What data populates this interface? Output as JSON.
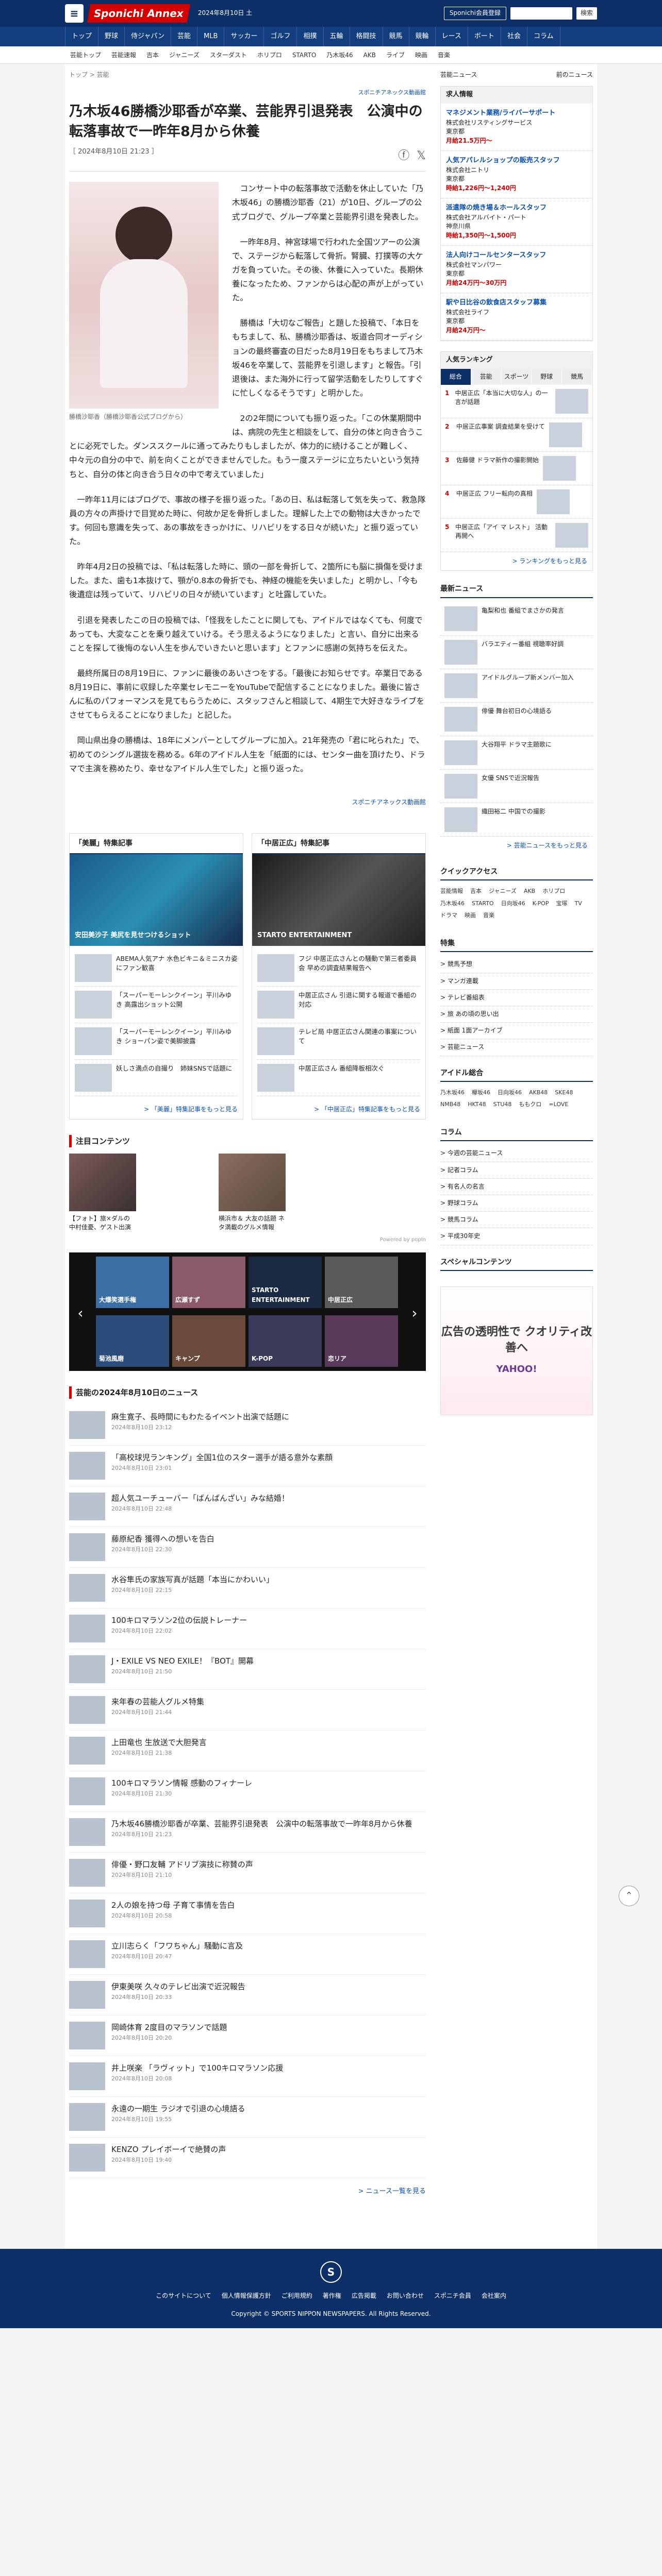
{
  "header": {
    "brand": "Sponichi Annex",
    "date": "2024年8月10日 土",
    "top_link": "Sponichi会員登録",
    "search_button": "検索"
  },
  "nav1": [
    "トップ",
    "野球",
    "侍ジャパン",
    "芸能",
    "MLB",
    "サッカー",
    "ゴルフ",
    "相撲",
    "五輪",
    "格闘技",
    "競馬",
    "競輪",
    "レース",
    "ボート",
    "社会",
    "コラム"
  ],
  "nav2": [
    "芸能トップ",
    "芸能速報",
    "吉本",
    "ジャニーズ",
    "スターダスト",
    "ホリプロ",
    "STARTO",
    "乃木坂46",
    "AKB",
    "ライブ",
    "映画",
    "音楽"
  ],
  "breadcrumb": "トップ > 芸能",
  "article": {
    "sponsor_label": "スポニチアネックス動画館",
    "title": "乃木坂46勝橋沙耶香が卒業、芸能界引退発表　公演中の転落事故で一昨年8月から休養",
    "datetime": "［ 2024年8月10日 21:23 ］",
    "caption": "勝橋沙耶香（勝橋沙耶香公式ブログから）",
    "paragraphs": [
      "コンサート中の転落事故で活動を休止していた「乃木坂46」の勝橋沙耶香（21）が10日、グループの公式ブログで、グループ卒業と芸能界引退を発表した。",
      "一昨年8月、神宮球場で行われた全国ツアーの公演で、ステージから転落して骨折。腎臓、打撲等の大ケガを負っていた。その後、休養に入っていた。長期休養になったため、ファンからは心配の声が上がっていた。",
      "勝橋は「大切なご報告」と題した投稿で、「本日をもちまして、私、勝橋沙耶香は、坂道合同オーディションの最終審査の日だった8月19日をもちまして乃木坂46を卒業して、芸能界を引退します」と報告。「引退後は、また海外に行って留学活動をしたりしてすぐに忙しくなるそうです」と明かした。",
      "2の2年間についても振り返った。「この休業期間中は、病院の先生と相談をして、自分の体と向き合うことに必死でした。ダンススクールに通ってみたりもしましたが、体力的に続けることが難しく、中々元の自分の中で、前を向くことができませんでした。もう一度ステージに立ちたいという気持ちと、自分の体と向き合う日々の中で考えていました」",
      "一昨年11月にはブログで、事故の様子を振り返った。「あの日、私は転落して気を失って、救急隊員の方々の声掛けで目覚めた時に、何故か足を骨折しました。理解した上での動物は大きかったです。何回も意識を失って、あの事故をきっかけに、リハビリをする日々が続いた」と振り返っていた。",
      "昨年4月2日の投稿では、「私は転落した時に、頭の一部を骨折して、2箇所にも脳に損傷を受けました。また、歯も1本抜けて、顎が0.8本の骨折でも、神経の機能を失いました」と明かし、「今も後遺症は残っていて、リハビリの日々が続いています」と吐露していた。",
      "引退を発表したこの日の投稿では、「怪我をしたことに関しても、アイドルではなくても、何度であっても、大変なことを乗り越えていける。そう思えるようになりました」と言い、自分に出来ることを探して後悔のない人生を歩んでいきたいと思います」とファンに感謝の気持ちを伝えた。",
      "最終所属日の8月19日に、ファンに最後のあいさつをする。「最後にお知らせです。卒業日である8月19日に、事前に収録した卒業セレモニーをYouTubeで配信することになりました。最後に皆さんに私のパフォーマンスを見てもらうために、スタッフさんと相談して、4期生で大好きなライブをさせてもらえることになりました」と記した。",
      "岡山県出身の勝橋は、18年にメンバーとしてグループに加入。21年発売の「君に叱られた」で、初めてのシングル選抜を務める。6年のアイドル人生を「紙面的には、センター曲を頂けたり、ドラマで主演を務めたり、幸せなアイドル人生でした」と振り返った。"
    ],
    "sponsor_bottom": "スポニチアネックス動画館"
  },
  "cards": [
    {
      "head": "「美麗」特集記事",
      "img_caption": "安田美沙子 美尻を見せつけるショット",
      "items": [
        "ABEMA人気アナ 水色ビキニ＆ミニスカ姿にファン歓喜",
        "「スーパーモーレンクイーン」平川みゆき 高露出ショット公開",
        "「スーパーモーレンクイーン」平川みゆき ショーパン姿で美脚披露",
        "妖しさ満点の自撮り　姉妹SNSで話題に"
      ],
      "more": "> 「美麗」特集記事をもっと見る"
    },
    {
      "head": "「中居正広」特集記事",
      "img_caption": "STARTO ENTERTAINMENT",
      "items": [
        "フジ 中居正広さんとの騒動で第三者委員会 早めの調査結果報告へ",
        "中居正広さん 引退に関する報道で番組の対応",
        "テレビ局 中居正広さん関連の事案について",
        "中居正広さん 番組降板相次ぐ"
      ],
      "more": "> 「中居正広」特集記事をもっと見る"
    }
  ],
  "attention": {
    "title": "注目コンテンツ",
    "items": [
      "【フォト】旅×ダルの中村佳憂、ゲスト出演",
      "横浜市＆ 大友の話題 ネタ満載のグルメ情報"
    ],
    "powered": "Powered by popIn"
  },
  "carousel": [
    "大爆笑選手権",
    "広瀬すず",
    "STARTO ENTERTAINMENT",
    "中居正広",
    "菊池風磨",
    "キャンプ",
    "K-POP",
    "恋リア"
  ],
  "news_list": {
    "title": "芸能の2024年8月10日のニュース",
    "items": [
      {
        "text": "麻生寛子、長時間にもわたるイベント出演で話題に",
        "date": "2024年8月10日 23:12"
      },
      {
        "text": "「高校球児ランキング」全国1位のスター選手が語る意外な素顔",
        "date": "2024年8月10日 23:01"
      },
      {
        "text": "超人気ユーチューバー「ばんばんざい」みな結婚！",
        "date": "2024年8月10日 22:48"
      },
      {
        "text": "藤原紀香 獲得への想いを告白",
        "date": "2024年8月10日 22:30"
      },
      {
        "text": "水谷隼氏の家族写真が話題「本当にかわいい」",
        "date": "2024年8月10日 22:15"
      },
      {
        "text": "100キロマラソン2位の伝説トレーナー",
        "date": "2024年8月10日 22:02"
      },
      {
        "text": "J・EXILE VS NEO EXILE！『BOT』開幕",
        "date": "2024年8月10日 21:50"
      },
      {
        "text": "来年春の芸能人グルメ特集",
        "date": "2024年8月10日 21:44"
      },
      {
        "text": "上田竜也 生放送で大胆発言",
        "date": "2024年8月10日 21:38"
      },
      {
        "text": "100キロマラソン情報 感動のフィナーレ",
        "date": "2024年8月10日 21:30"
      },
      {
        "text": "乃木坂46勝橋沙耶香が卒業、芸能界引退発表　公演中の転落事故で一昨年8月から休養",
        "date": "2024年8月10日 21:23"
      },
      {
        "text": "俳優・野口友輔 アドリブ演技に称賛の声",
        "date": "2024年8月10日 21:10"
      },
      {
        "text": "2人の娘を持つ母 子育て事情を告白",
        "date": "2024年8月10日 20:58"
      },
      {
        "text": "立川志らく「フワちゃん」騒動に言及",
        "date": "2024年8月10日 20:47"
      },
      {
        "text": "伊東美咲 久々のテレビ出演で近況報告",
        "date": "2024年8月10日 20:33"
      },
      {
        "text": "岡崎体育 2度目のマラソンで話題",
        "date": "2024年8月10日 20:20"
      },
      {
        "text": "井上咲楽 「ラヴィット」で100キロマラソン応援",
        "date": "2024年8月10日 20:08"
      },
      {
        "text": "永遠の一期生 ラジオで引退の心境語る",
        "date": "2024年8月10日 19:55"
      },
      {
        "text": "KENZO プレイボーイで絶賛の声",
        "date": "2024年8月10日 19:40"
      }
    ],
    "more": "> ニュース一覧を見る"
  },
  "sidebar": {
    "news_label": "芸能ニュース",
    "prev_label": "前のニュース",
    "jobs_title": "求人情報",
    "jobs": [
      {
        "title": "マネジメント業務/ライバーサポート",
        "company": "株式会社リスティングサービス",
        "place": "東京都",
        "wage": "月給21.5万円～"
      },
      {
        "title": "人気アパレルショップの販売スタッフ",
        "company": "株式会社ニトリ",
        "place": "東京都",
        "wage": "時給1,226円～1,240円"
      },
      {
        "title": "派遣隊の焼き場＆ホールスタッフ",
        "company": "株式会社アルバイト・パート",
        "place": "神奈川県",
        "wage": "時給1,350円～1,500円"
      },
      {
        "title": "法人向けコールセンタースタッフ",
        "company": "株式会社マンパワー",
        "place": "東京都",
        "wage": "月給24万円～30万円"
      },
      {
        "title": "駅や日比谷の飲食店スタッフ募集",
        "company": "株式会社ライフ",
        "place": "東京都",
        "wage": "月給24万円～"
      }
    ],
    "ranking_title": "人気ランキング",
    "ranking_tabs": [
      "総合",
      "芸能",
      "スポーツ",
      "野球",
      "競馬"
    ],
    "ranking": [
      "中居正広「本当に大切な人」の一言が話題",
      "中居正広事案 調査結果を受けて",
      "佐藤健 ドラマ新作の撮影開始",
      "中居正広 フリー転向の真相",
      "中居正広「アイ マ レスト」 活動再開へ"
    ],
    "ranking_more": "> ランキングをもっと見る",
    "latest_title": "最新ニュース",
    "latest": [
      "亀梨和也 番組でまさかの発言",
      "バラエティー番組 視聴率好調",
      "アイドルグループ新メンバー加入",
      "俳優 舞台初日の心境語る",
      "大谷翔平 ドラマ主題歌に",
      "女優 SNSで近況報告",
      "織田裕二 中国での撮影"
    ],
    "latest_more": "> 芸能ニュースをもっと見る",
    "quick_title": "クイックアクセス",
    "quick_tags": [
      "芸能情報",
      "吉本",
      "ジャニーズ",
      "AKB",
      "ホリプロ",
      "乃木坂46",
      "STARTO",
      "日向坂46",
      "K-POP",
      "宝塚",
      "TV",
      "ドラマ",
      "映画",
      "音楽"
    ],
    "special_title": "特集",
    "specials": [
      "> 競馬予想",
      "> マンガ連載",
      "> テレビ番組表",
      "> 旅 あの頃の思い出",
      "> 紙面 1面アーカイブ",
      "> 芸能ニュース"
    ],
    "idol_title": "アイドル総合",
    "idol_tags": [
      "乃木坂46",
      "欅坂46",
      "日向坂46",
      "AKB48",
      "SKE48",
      "NMB48",
      "HKT48",
      "STU48",
      "ももクロ",
      "=LOVE"
    ],
    "column_title": "コラム",
    "columns": [
      "> 今週の芸能ニュース",
      "> 記者コラム",
      "> 有名人の名言",
      "> 野球コラム",
      "> 競馬コラム",
      "> 平成30年史"
    ],
    "special_contents_title": "スペシャルコンテンツ",
    "ad_text": "広告の透明性で クオリティ改善へ",
    "ad_logo": "YAHOO!"
  },
  "footer": {
    "links": [
      "このサイトについて",
      "個人情報保護方針",
      "ご利用規約",
      "著作権",
      "広告掲載",
      "お問い合わせ",
      "スポニチ会員",
      "会社案内"
    ],
    "copyright": "Copyright © SPORTS NIPPON NEWSPAPERS. All Rights Reserved."
  }
}
